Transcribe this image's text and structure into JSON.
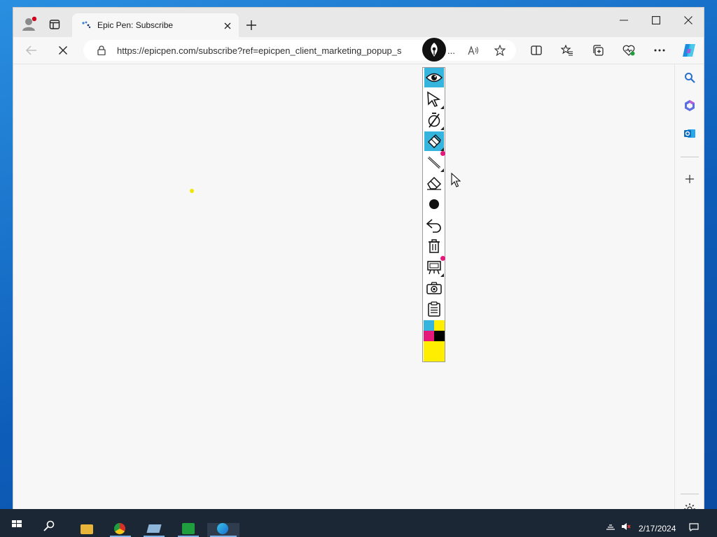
{
  "browser": {
    "tab": {
      "title": "Epic Pen: Subscribe",
      "favicon": "epic-pen-dots-icon"
    },
    "address": {
      "url": "https://epicpen.com/subscribe?ref=epicpen_client_marketing_popup_s",
      "ellipsis": "..."
    },
    "colors": {
      "frame": "#e8e8e8",
      "page": "#f7f7f7",
      "accent": "#0f6cbd"
    }
  },
  "epic_pen": {
    "tools": [
      {
        "name": "eye-icon",
        "active": true
      },
      {
        "name": "cursor-icon",
        "active": false
      },
      {
        "name": "pen-icon",
        "active": false
      },
      {
        "name": "highlighter-icon",
        "active": true
      },
      {
        "name": "line-icon",
        "active": false
      },
      {
        "name": "eraser-icon",
        "active": false
      },
      {
        "name": "brush-size-icon",
        "active": false
      },
      {
        "name": "undo-icon",
        "active": false
      },
      {
        "name": "trash-icon",
        "active": false
      },
      {
        "name": "whiteboard-icon",
        "active": false
      },
      {
        "name": "camera-icon",
        "active": false
      },
      {
        "name": "clipboard-icon",
        "active": false
      }
    ],
    "palette": [
      "#35b4de",
      "#ffee00",
      "#e6177a",
      "#000000"
    ],
    "current_color": "#ffee00",
    "active_color": "#35b4de",
    "badge_color": "#e6177a"
  },
  "taskbar": {
    "date": "2/17/2024"
  }
}
